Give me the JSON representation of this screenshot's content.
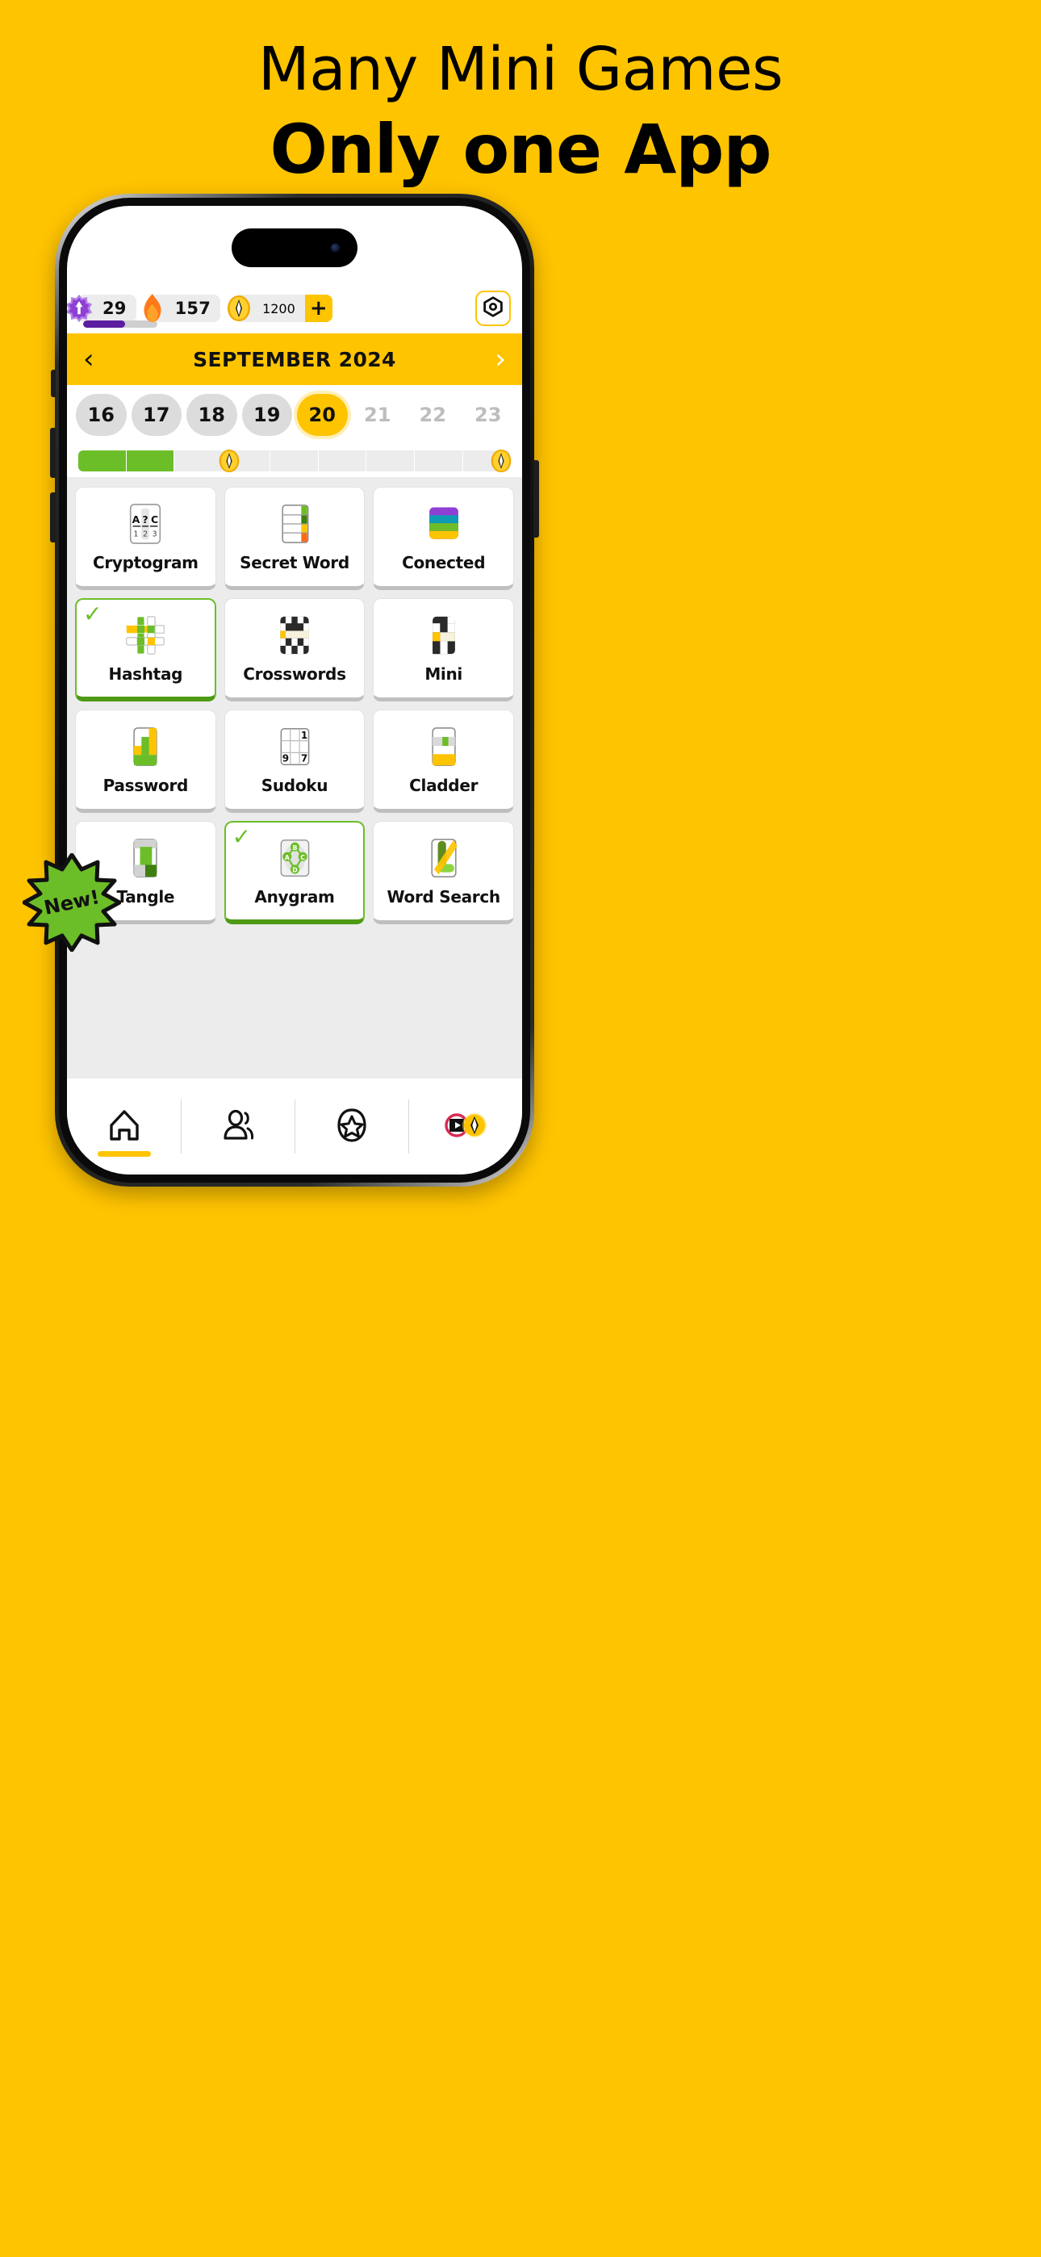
{
  "headline": {
    "line1": "Many Mini Games",
    "line2": "Only one App"
  },
  "colors": {
    "background": "#FFC400",
    "accent_yellow": "#FFC400",
    "green": "#6CBE28",
    "green_dark": "#4E9A14",
    "purple": "#5B1E9E",
    "orange": "#FF7A18"
  },
  "stats": {
    "level": {
      "icon": "level-star-badge",
      "value": "29",
      "progress_percent": 57
    },
    "streak": {
      "icon": "flame-icon",
      "value": "157"
    },
    "coins": {
      "icon": "coin-icon",
      "value": "1200",
      "add_label": "+"
    },
    "settings": {
      "icon": "settings-nut-icon"
    }
  },
  "calendar": {
    "prev_label": "‹",
    "next_label": "›",
    "month_title": "SEPTEMBER 2024",
    "days": [
      {
        "label": "16",
        "state": "past"
      },
      {
        "label": "17",
        "state": "past"
      },
      {
        "label": "18",
        "state": "past"
      },
      {
        "label": "19",
        "state": "past"
      },
      {
        "label": "20",
        "state": "today"
      },
      {
        "label": "21",
        "state": "future"
      },
      {
        "label": "22",
        "state": "future"
      },
      {
        "label": "23",
        "state": "future"
      }
    ]
  },
  "daily_progress": {
    "total_segments": 9,
    "filled_segments": 2,
    "reward_markers": [
      {
        "icon": "coin-icon",
        "at_percent": 33
      },
      {
        "icon": "coin-icon",
        "at_percent": 96
      }
    ]
  },
  "new_badge": {
    "label": "New!"
  },
  "games": [
    {
      "name": "Cryptogram",
      "icon": "cryptogram-icon",
      "completed": false
    },
    {
      "name": "Secret Word",
      "icon": "secret-word-icon",
      "completed": false
    },
    {
      "name": "Conected",
      "icon": "conected-icon",
      "completed": false
    },
    {
      "name": "Hashtag",
      "icon": "hashtag-icon",
      "completed": true
    },
    {
      "name": "Crosswords",
      "icon": "crosswords-icon",
      "completed": false
    },
    {
      "name": "Mini",
      "icon": "mini-icon",
      "completed": false
    },
    {
      "name": "Password",
      "icon": "password-icon",
      "completed": false
    },
    {
      "name": "Sudoku",
      "icon": "sudoku-icon",
      "completed": false
    },
    {
      "name": "Cladder",
      "icon": "cladder-icon",
      "completed": false
    },
    {
      "name": "Tangle",
      "icon": "tangle-icon",
      "completed": false
    },
    {
      "name": "Anygram",
      "icon": "anygram-icon",
      "completed": true
    },
    {
      "name": "Word Search",
      "icon": "word-search-icon",
      "completed": false
    }
  ],
  "game_icon_text": {
    "cryptogram_letters": [
      "A",
      "?",
      "C"
    ],
    "cryptogram_numbers": [
      "1",
      "2",
      "3"
    ],
    "sudoku_cells": [
      "",
      "",
      "1",
      "",
      "",
      "",
      "9",
      "",
      "7"
    ],
    "anygram_nodes": [
      "B",
      "A",
      "C",
      "D"
    ]
  },
  "checkmark": "✓",
  "bottom_nav": [
    {
      "name": "home",
      "icon": "home-icon",
      "active": true
    },
    {
      "name": "friends",
      "icon": "people-icon",
      "active": false
    },
    {
      "name": "awards",
      "icon": "star-icon",
      "active": false
    },
    {
      "name": "rewards",
      "icon": "video-coin-icon",
      "active": false
    }
  ]
}
